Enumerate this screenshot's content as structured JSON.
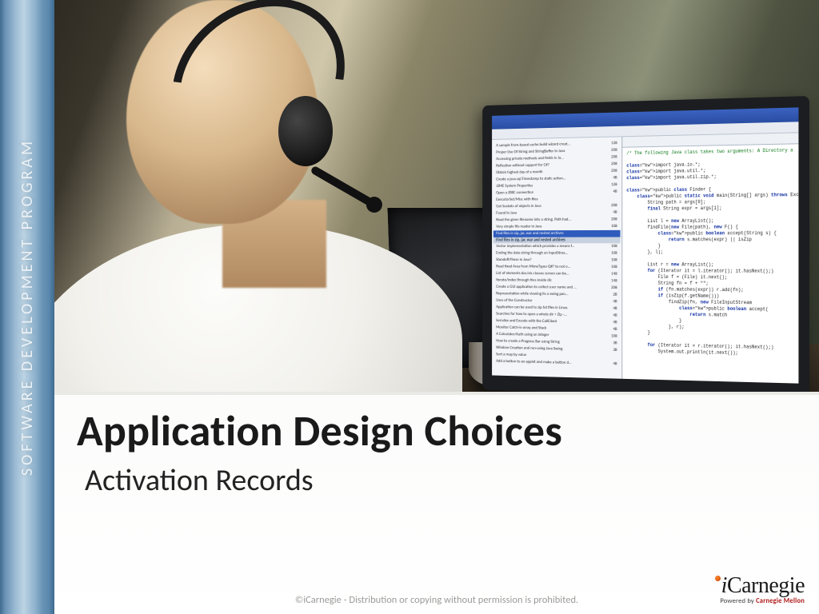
{
  "sidebar": {
    "label": "SOFTWARE DEVELOPMENT PROGRAM"
  },
  "title": {
    "main": "Application Design Choices",
    "sub": "Activation Records"
  },
  "footer": {
    "copyright": "©iCarnegie - Distribution or copying without permission is prohibited."
  },
  "brand": {
    "name": "Carnegie",
    "prefix": "i",
    "powered_prefix": "Powered by ",
    "powered_name": "Carnegie Mellon"
  },
  "ide": {
    "left_items_top": [
      {
        "name": "A sample from-based cache build wizard creat...",
        "size": "128"
      },
      {
        "name": "Proper Use Of String and StringBuffer In Java",
        "size": "208"
      },
      {
        "name": "Accessing private methods and fields in Ja...",
        "size": "208"
      },
      {
        "name": "Reflection without support for C#?",
        "size": "208"
      },
      {
        "name": "Obtain highest day of a month",
        "size": "208"
      },
      {
        "name": "Create a java.sql.Timestamp to static action...",
        "size": "4B"
      },
      {
        "name": "J2ME System Properties",
        "size": "128"
      },
      {
        "name": "Open a JDBC connection",
        "size": "4B"
      },
      {
        "name": "ExecutorSet/Misc with files",
        "size": ""
      },
      {
        "name": "Get Sockets of objects in Java",
        "size": "208"
      },
      {
        "name": "Found In Java",
        "size": "4B"
      },
      {
        "name": "Read the given filename into a string. Path had...",
        "size": "208"
      },
      {
        "name": "Very simple file reader in Java",
        "size": "108"
      }
    ],
    "left_sel": "Find files in zip, jar, war and nested archives",
    "left_items_bottom": [
      {
        "name": "Vector implementation which provides a means f...",
        "size": "108"
      },
      {
        "name": "Ending the data string through an InputStrea...",
        "size": "108"
      },
      {
        "name": "Standoff/Parse in Java?",
        "size": "108"
      },
      {
        "name": "Read fixed Area from MimeTypes Q#? to not o...",
        "size": "108"
      },
      {
        "name": "List of elements doc/xls classes screen can be...",
        "size": "148"
      },
      {
        "name": "Iterate/index through files inside dir.",
        "size": "148"
      },
      {
        "name": "Create a GUI application to collect user name and ...",
        "size": "208"
      },
      {
        "name": "Representation while viewing its a swing pan...",
        "size": "2B"
      },
      {
        "name": "Uses of the Constructor",
        "size": "4B"
      },
      {
        "name": "Application can be used to zip txt files in Linux.",
        "size": "4B"
      },
      {
        "name": "Searches for how to open a whole dir + Zip -...",
        "size": "4B"
      },
      {
        "name": "Serialize and Encode with the CallClient",
        "size": "4B"
      },
      {
        "name": "Monitor Catch-is-array and Stack",
        "size": "4B"
      },
      {
        "name": "A Calculator/Auth using an integer",
        "size": "108"
      },
      {
        "name": "How to create a Progress Bar using String",
        "size": "3B"
      },
      {
        "name": "Window Creation and run-using Java Swing",
        "size": "3B"
      },
      {
        "name": "Sort a map by value",
        "size": ""
      },
      {
        "name": "Add a button to an applet and make a button d...",
        "size": "4B"
      }
    ],
    "code_lines": [
      "/* The following Java class takes two arguments: A Directory a",
      "",
      "import java.io.*;",
      "import java.util.*;",
      "import java.util.zip.*;",
      "",
      "public class Finder {",
      "    public static void main(String[] args) throws Exception",
      "        String path = args[0];",
      "        final String expr = args[1];",
      "",
      "        List l = new ArrayList();",
      "        findFile(new File(path), new F() {",
      "            public boolean accept(String s) {",
      "                return s.matches(expr) || isZip",
      "            }",
      "        }, l);",
      "",
      "        List r = new ArrayList();",
      "        for (Iterator it = l.iterator(); it.hasNext();)",
      "            File f = (File) it.next();",
      "            String fn = f + \"\";",
      "            if (fn.matches(expr)) r.add(fn);",
      "            if (isZip(f.getName()))",
      "                findZip(fn, new FileInputStream",
      "                    public boolean accept(",
      "                        return s.match",
      "                    }",
      "                }, r);",
      "        }",
      "",
      "        for (Iterator it = r.iterator(); it.hasNext();)",
      "            System.out.println(it.next());",
      ""
    ]
  }
}
